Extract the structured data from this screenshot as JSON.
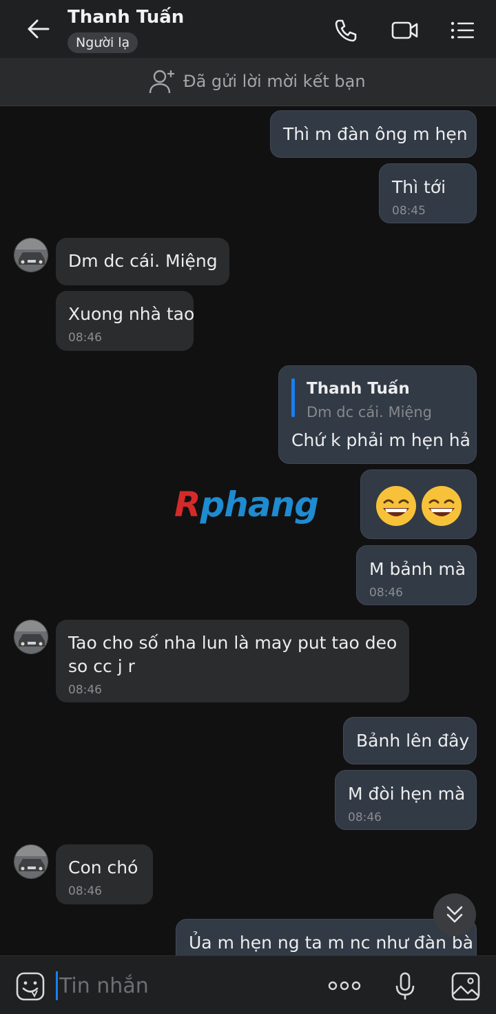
{
  "header": {
    "contact_name": "Thanh Tuấn",
    "badge": "Người lạ"
  },
  "friend_bar": {
    "text": "Đã gửi lời mời kết bạn"
  },
  "messages": [
    {
      "dir": "out",
      "text": "Thì m đàn ông m hẹn"
    },
    {
      "dir": "out",
      "text": "Thì tới",
      "time": "08:45"
    },
    {
      "dir": "in",
      "text": "Dm dc cái. Miệng"
    },
    {
      "dir": "in",
      "text": "Xuong nhà tao",
      "time": "08:46"
    },
    {
      "dir": "out",
      "reply_to_name": "Thanh Tuấn",
      "reply_to_text": "Dm dc cái. Miệng",
      "text": "Chứ k phải m hẹn hả"
    },
    {
      "dir": "out",
      "emoji": "😄😄"
    },
    {
      "dir": "out",
      "text": "M bảnh mà",
      "time": "08:46"
    },
    {
      "dir": "in",
      "text_line1": "Tao cho số nha lun là may put tao deo",
      "text_line2": "so cc j r",
      "time": "08:46"
    },
    {
      "dir": "out",
      "text": "Bảnh lên đây"
    },
    {
      "dir": "out",
      "text": "M đòi hẹn mà",
      "time": "08:46"
    },
    {
      "dir": "in",
      "text": "Con chó",
      "time": "08:46"
    },
    {
      "dir": "out",
      "text": "Ủa m hẹn ng ta m nc như đàn bà"
    }
  ],
  "watermark": {
    "first": "R",
    "rest": "phang"
  },
  "input": {
    "placeholder": "Tin nhắn"
  },
  "colors": {
    "accent": "#1a7ff0",
    "outgoing_bubble": "#323a45",
    "incoming_bubble": "#2b2c2e",
    "background": "#111112"
  }
}
